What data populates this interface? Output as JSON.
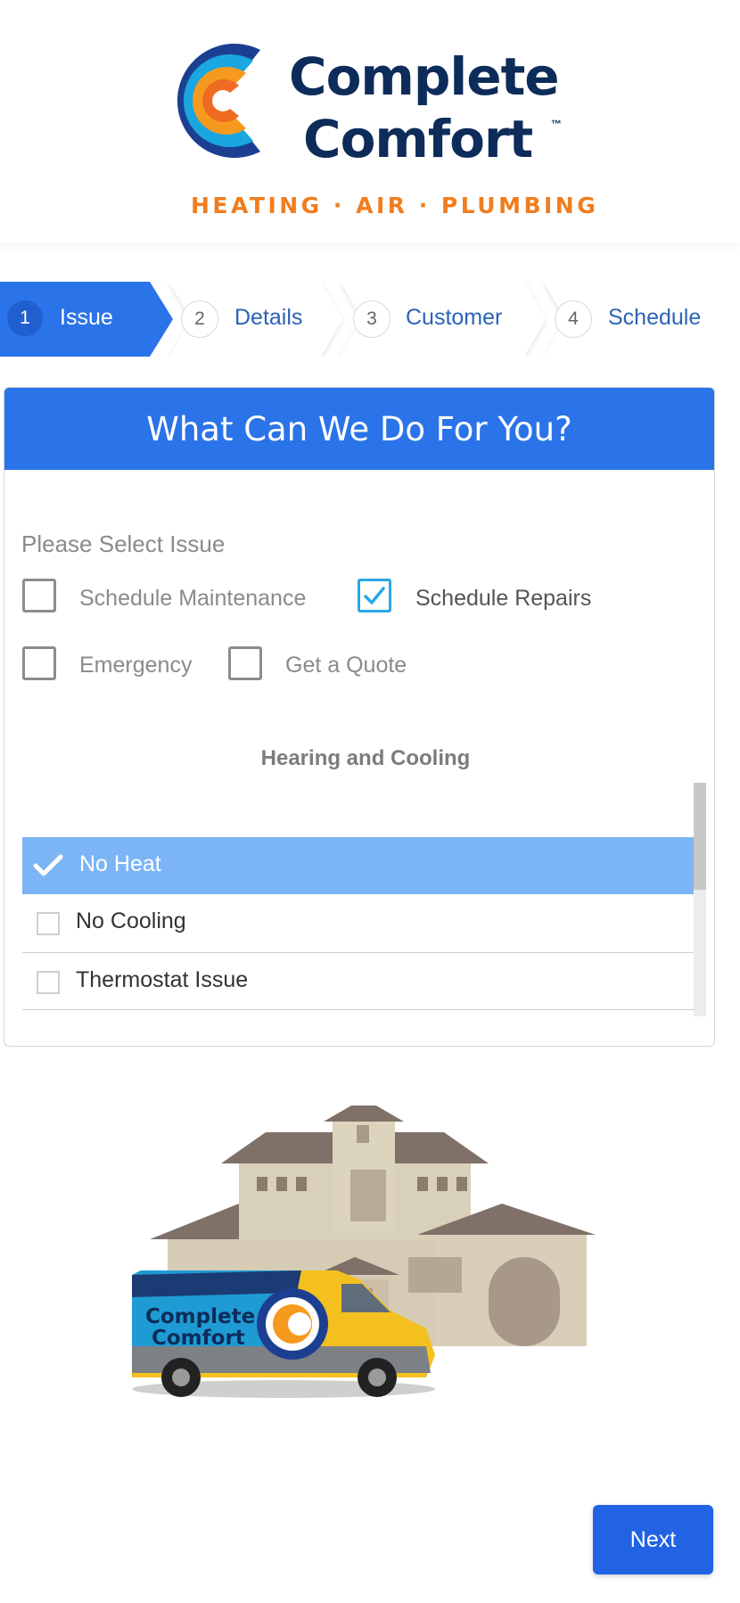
{
  "brand": {
    "line1": "Complete",
    "line2": "Comfort",
    "tm": "™",
    "tagline": "HEATING · AIR · PLUMBING",
    "colors": {
      "navy": "#0d2c5a",
      "orange": "#f07d1f",
      "blue": "#2b73e8"
    }
  },
  "steps": [
    {
      "number": "1",
      "label": "Issue",
      "active": true
    },
    {
      "number": "2",
      "label": "Details",
      "active": false
    },
    {
      "number": "3",
      "label": "Customer",
      "active": false
    },
    {
      "number": "4",
      "label": "Schedule",
      "active": false
    }
  ],
  "card": {
    "title": "What Can We Do For You?",
    "select_label": "Please Select Issue",
    "issue_types": [
      {
        "label": "Schedule Maintenance",
        "checked": false
      },
      {
        "label": "Schedule Repairs",
        "checked": true
      },
      {
        "label": "Emergency",
        "checked": false
      },
      {
        "label": "Get a Quote",
        "checked": false
      }
    ],
    "section_title": "Hearing and Cooling",
    "issues": [
      {
        "label": "No Heat",
        "selected": true
      },
      {
        "label": "No Cooling",
        "selected": false
      },
      {
        "label": "Thermostat Issue",
        "selected": false
      }
    ]
  },
  "van": {
    "line1": "Complete",
    "line2": "Comfort"
  },
  "actions": {
    "next_label": "Next"
  }
}
